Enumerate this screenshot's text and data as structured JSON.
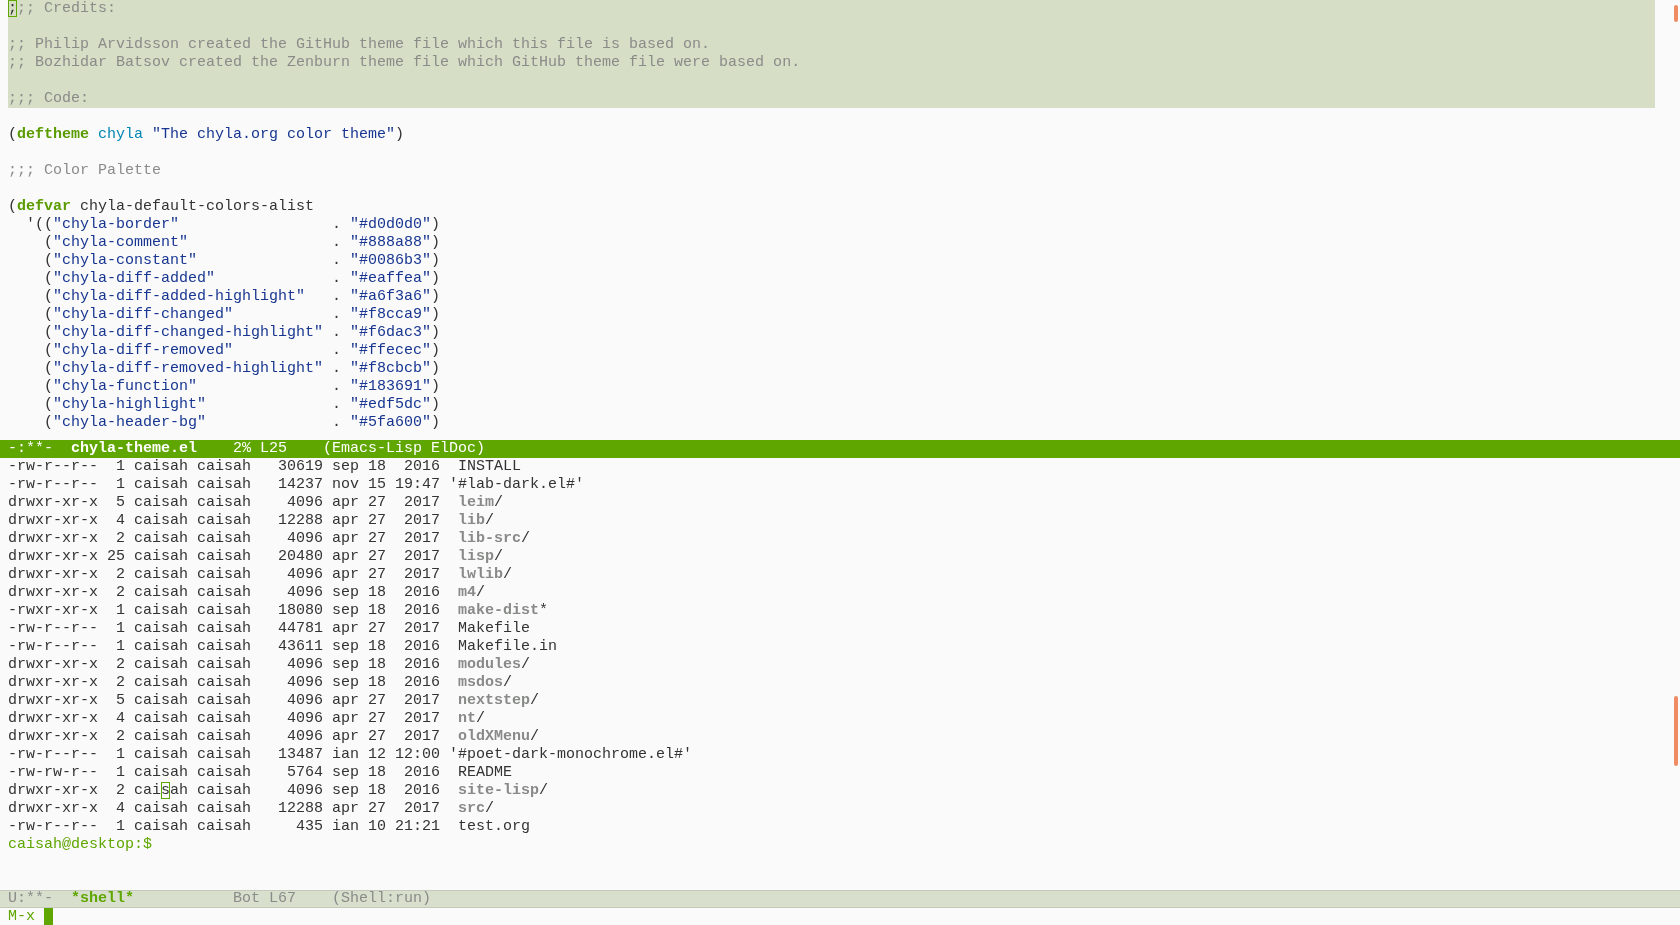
{
  "windows": [
    {
      "kind": "code",
      "lines": [
        {
          "highlighted": true,
          "segments": [
            {
              "text": ";",
              "kind": "cursor"
            },
            {
              "text": ";; Credits:",
              "kind": "comment"
            }
          ]
        },
        {
          "highlighted": true
        },
        {
          "highlighted": true,
          "segments": [
            {
              "text": ";; Philip Arvidsson created the GitHub theme file which this file is based on.",
              "kind": "comment"
            }
          ]
        },
        {
          "highlighted": true,
          "segments": [
            {
              "text": ";; Bozhidar Batsov created the Zenburn theme file which GitHub theme file were based on.",
              "kind": "comment"
            }
          ]
        },
        {
          "highlighted": true
        },
        {
          "highlighted": true,
          "segments": [
            {
              "text": ";;; Code:",
              "kind": "comment"
            }
          ]
        },
        {
          "highlighted": false
        },
        {
          "highlighted": false,
          "segments": [
            {
              "text": "(",
              "kind": "plain"
            },
            {
              "text": "deftheme ",
              "kind": "keyword"
            },
            {
              "text": "chyla ",
              "kind": "constant"
            },
            {
              "text": "\"The chyla.org color theme\"",
              "kind": "string"
            },
            {
              "text": ")",
              "kind": "plain"
            }
          ]
        },
        {
          "highlighted": false
        },
        {
          "highlighted": false,
          "segments": [
            {
              "text": ";;; Color Palette",
              "kind": "comment"
            }
          ]
        },
        {
          "highlighted": false
        },
        {
          "highlighted": false,
          "segments": [
            {
              "text": "(",
              "kind": "plain"
            },
            {
              "text": "defvar",
              "kind": "keyword"
            },
            {
              "text": " chyla-default-colors-alist",
              "kind": "plain"
            }
          ]
        },
        {
          "highlighted": false,
          "segments": [
            {
              "text": "  '((",
              "kind": "plain"
            },
            {
              "text": "\"chyla-border\"",
              "kind": "string"
            },
            {
              "text": "                 . ",
              "kind": "plain"
            },
            {
              "text": "\"#d0d0d0\"",
              "kind": "string"
            },
            {
              "text": ")",
              "kind": "plain"
            }
          ]
        },
        {
          "highlighted": false,
          "segments": [
            {
              "text": "    (",
              "kind": "plain"
            },
            {
              "text": "\"chyla-comment\"",
              "kind": "string"
            },
            {
              "text": "                . ",
              "kind": "plain"
            },
            {
              "text": "\"#888a88\"",
              "kind": "string"
            },
            {
              "text": ")",
              "kind": "plain"
            }
          ]
        },
        {
          "highlighted": false,
          "segments": [
            {
              "text": "    (",
              "kind": "plain"
            },
            {
              "text": "\"chyla-constant\"",
              "kind": "string"
            },
            {
              "text": "               . ",
              "kind": "plain"
            },
            {
              "text": "\"#0086b3\"",
              "kind": "string"
            },
            {
              "text": ")",
              "kind": "plain"
            }
          ]
        },
        {
          "highlighted": false,
          "segments": [
            {
              "text": "    (",
              "kind": "plain"
            },
            {
              "text": "\"chyla-diff-added\"",
              "kind": "string"
            },
            {
              "text": "             . ",
              "kind": "plain"
            },
            {
              "text": "\"#eaffea\"",
              "kind": "string"
            },
            {
              "text": ")",
              "kind": "plain"
            }
          ]
        },
        {
          "highlighted": false,
          "segments": [
            {
              "text": "    (",
              "kind": "plain"
            },
            {
              "text": "\"chyla-diff-added-highlight\"",
              "kind": "string"
            },
            {
              "text": "   . ",
              "kind": "plain"
            },
            {
              "text": "\"#a6f3a6\"",
              "kind": "string"
            },
            {
              "text": ")",
              "kind": "plain"
            }
          ]
        },
        {
          "highlighted": false,
          "segments": [
            {
              "text": "    (",
              "kind": "plain"
            },
            {
              "text": "\"chyla-diff-changed\"",
              "kind": "string"
            },
            {
              "text": "           . ",
              "kind": "plain"
            },
            {
              "text": "\"#f8cca9\"",
              "kind": "string"
            },
            {
              "text": ")",
              "kind": "plain"
            }
          ]
        },
        {
          "highlighted": false,
          "segments": [
            {
              "text": "    (",
              "kind": "plain"
            },
            {
              "text": "\"chyla-diff-changed-highlight\"",
              "kind": "string"
            },
            {
              "text": " . ",
              "kind": "plain"
            },
            {
              "text": "\"#f6dac3\"",
              "kind": "string"
            },
            {
              "text": ")",
              "kind": "plain"
            }
          ]
        },
        {
          "highlighted": false,
          "segments": [
            {
              "text": "    (",
              "kind": "plain"
            },
            {
              "text": "\"chyla-diff-removed\"",
              "kind": "string"
            },
            {
              "text": "           . ",
              "kind": "plain"
            },
            {
              "text": "\"#ffecec\"",
              "kind": "string"
            },
            {
              "text": ")",
              "kind": "plain"
            }
          ]
        },
        {
          "highlighted": false,
          "segments": [
            {
              "text": "    (",
              "kind": "plain"
            },
            {
              "text": "\"chyla-diff-removed-highlight\"",
              "kind": "string"
            },
            {
              "text": " . ",
              "kind": "plain"
            },
            {
              "text": "\"#f8cbcb\"",
              "kind": "string"
            },
            {
              "text": ")",
              "kind": "plain"
            }
          ]
        },
        {
          "highlighted": false,
          "segments": [
            {
              "text": "    (",
              "kind": "plain"
            },
            {
              "text": "\"chyla-function\"",
              "kind": "string"
            },
            {
              "text": "               . ",
              "kind": "plain"
            },
            {
              "text": "\"#183691\"",
              "kind": "string"
            },
            {
              "text": ")",
              "kind": "plain"
            }
          ]
        },
        {
          "highlighted": false,
          "segments": [
            {
              "text": "    (",
              "kind": "plain"
            },
            {
              "text": "\"chyla-highlight\"",
              "kind": "string"
            },
            {
              "text": "              . ",
              "kind": "plain"
            },
            {
              "text": "\"#edf5dc\"",
              "kind": "string"
            },
            {
              "text": ")",
              "kind": "plain"
            }
          ]
        },
        {
          "highlighted": false,
          "segments": [
            {
              "text": "    (",
              "kind": "plain"
            },
            {
              "text": "\"chyla-header-bg\"",
              "kind": "string"
            },
            {
              "text": "              . ",
              "kind": "plain"
            },
            {
              "text": "\"#5fa600\"",
              "kind": "string"
            },
            {
              "text": ")",
              "kind": "plain"
            }
          ]
        }
      ],
      "mode_line": {
        "state": "-:**-",
        "buffer": "chyla-theme.el",
        "position": "2% L25",
        "modes": "(Emacs-Lisp ElDoc)",
        "active": true
      }
    },
    {
      "kind": "shell",
      "lines": [
        {
          "segments": [
            {
              "text": "-rw-r--r--  1 caisah caisah   30619 sep 18  2016  INSTALL",
              "kind": "plain"
            }
          ]
        },
        {
          "segments": [
            {
              "text": "-rw-r--r--  1 caisah caisah   14237 nov 15 19:47 '#lab-dark.el#'",
              "kind": "plain"
            }
          ]
        },
        {
          "segments": [
            {
              "text": "drwxr-xr-x  5 caisah caisah    4096 apr 27  2017  ",
              "kind": "plain"
            },
            {
              "text": "leim",
              "kind": "dir"
            },
            {
              "text": "/",
              "kind": "plain"
            }
          ]
        },
        {
          "segments": [
            {
              "text": "drwxr-xr-x  4 caisah caisah   12288 apr 27  2017  ",
              "kind": "plain"
            },
            {
              "text": "lib",
              "kind": "dir"
            },
            {
              "text": "/",
              "kind": "plain"
            }
          ]
        },
        {
          "segments": [
            {
              "text": "drwxr-xr-x  2 caisah caisah    4096 apr 27  2017  ",
              "kind": "plain"
            },
            {
              "text": "lib-src",
              "kind": "dir"
            },
            {
              "text": "/",
              "kind": "plain"
            }
          ]
        },
        {
          "segments": [
            {
              "text": "drwxr-xr-x 25 caisah caisah   20480 apr 27  2017  ",
              "kind": "plain"
            },
            {
              "text": "lisp",
              "kind": "dir"
            },
            {
              "text": "/",
              "kind": "plain"
            }
          ]
        },
        {
          "segments": [
            {
              "text": "drwxr-xr-x  2 caisah caisah    4096 apr 27  2017  ",
              "kind": "plain"
            },
            {
              "text": "lwlib",
              "kind": "dir"
            },
            {
              "text": "/",
              "kind": "plain"
            }
          ]
        },
        {
          "segments": [
            {
              "text": "drwxr-xr-x  2 caisah caisah    4096 sep 18  2016  ",
              "kind": "plain"
            },
            {
              "text": "m4",
              "kind": "dir"
            },
            {
              "text": "/",
              "kind": "plain"
            }
          ]
        },
        {
          "segments": [
            {
              "text": "-rwxr-xr-x  1 caisah caisah   18080 sep 18  2016  ",
              "kind": "plain"
            },
            {
              "text": "make-dist",
              "kind": "exec"
            },
            {
              "text": "*",
              "kind": "plain"
            }
          ]
        },
        {
          "segments": [
            {
              "text": "-rw-r--r--  1 caisah caisah   44781 apr 27  2017  Makefile",
              "kind": "plain"
            }
          ]
        },
        {
          "segments": [
            {
              "text": "-rw-r--r--  1 caisah caisah   43611 sep 18  2016  Makefile.in",
              "kind": "plain"
            }
          ]
        },
        {
          "segments": [
            {
              "text": "drwxr-xr-x  2 caisah caisah    4096 sep 18  2016  ",
              "kind": "plain"
            },
            {
              "text": "modules",
              "kind": "dir"
            },
            {
              "text": "/",
              "kind": "plain"
            }
          ]
        },
        {
          "segments": [
            {
              "text": "drwxr-xr-x  2 caisah caisah    4096 sep 18  2016  ",
              "kind": "plain"
            },
            {
              "text": "msdos",
              "kind": "dir"
            },
            {
              "text": "/",
              "kind": "plain"
            }
          ]
        },
        {
          "segments": [
            {
              "text": "drwxr-xr-x  5 caisah caisah    4096 apr 27  2017  ",
              "kind": "plain"
            },
            {
              "text": "nextstep",
              "kind": "dir"
            },
            {
              "text": "/",
              "kind": "plain"
            }
          ]
        },
        {
          "segments": [
            {
              "text": "drwxr-xr-x  4 caisah caisah    4096 apr 27  2017  ",
              "kind": "plain"
            },
            {
              "text": "nt",
              "kind": "dir"
            },
            {
              "text": "/",
              "kind": "plain"
            }
          ]
        },
        {
          "segments": [
            {
              "text": "drwxr-xr-x  2 caisah caisah    4096 apr 27  2017  ",
              "kind": "plain"
            },
            {
              "text": "oldXMenu",
              "kind": "dir"
            },
            {
              "text": "/",
              "kind": "plain"
            }
          ]
        },
        {
          "segments": [
            {
              "text": "-rw-r--r--  1 caisah caisah   13487 ian 12 12:00 '#poet-dark-monochrome.el#'",
              "kind": "plain"
            }
          ]
        },
        {
          "segments": [
            {
              "text": "-rw-rw-r--  1 caisah caisah    5764 sep 18  2016  README",
              "kind": "plain"
            }
          ]
        },
        {
          "segments": [
            {
              "text": "drwxr-xr-x  2 cai",
              "kind": "plain"
            },
            {
              "text": "s",
              "kind": "cursor"
            },
            {
              "text": "ah caisah    4096 sep 18  2016  ",
              "kind": "plain"
            },
            {
              "text": "site-lisp",
              "kind": "dir"
            },
            {
              "text": "/",
              "kind": "plain"
            }
          ]
        },
        {
          "segments": [
            {
              "text": "drwxr-xr-x  4 caisah caisah   12288 apr 27  2017  ",
              "kind": "plain"
            },
            {
              "text": "src",
              "kind": "dir"
            },
            {
              "text": "/",
              "kind": "plain"
            }
          ]
        },
        {
          "segments": [
            {
              "text": "-rw-r--r--  1 caisah caisah     435 ian 10 21:21  test.org",
              "kind": "plain"
            }
          ]
        },
        {
          "segments": [
            {
              "text": "caisah@desktop:$",
              "kind": "prompt"
            }
          ]
        }
      ],
      "mode_line": {
        "state": "U:**-",
        "buffer": "*shell*",
        "position": "Bot L67",
        "modes": "(Shell:run)",
        "active": false
      }
    }
  ],
  "minibuffer": {
    "prompt": "M-x",
    "cursor": true
  }
}
